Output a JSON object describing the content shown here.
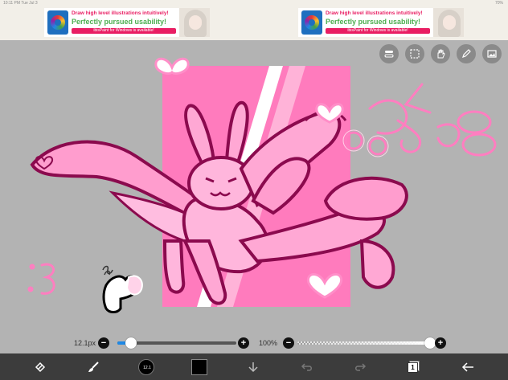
{
  "status_bar": {
    "time": "10:11 PM  Tue Jul 3",
    "right": "70%"
  },
  "ads": [
    {
      "line1": "Draw high level illustrations intuitively!",
      "line2": "Perfectly pursued usability!",
      "cta": "ibisPaint for Windows is available!"
    },
    {
      "line1": "Draw high level illustrations intuitively!",
      "line2": "Perfectly pursued usability!",
      "cta": "ibisPaint for Windows is available!"
    }
  ],
  "top_tools": [
    "layers-toggle-icon",
    "selection-icon",
    "hand-icon",
    "pen-icon",
    "image-icon"
  ],
  "brush": {
    "size_label": "12.1px",
    "size_value": 0.08,
    "opacity_label": "100%",
    "opacity_value": 1.0
  },
  "bottom_bar": {
    "brush_circle_label": "12.1",
    "layers_count": "1",
    "icons": [
      "transform-icon",
      "brush-icon",
      "brush-size-icon",
      "color-icon",
      "download-icon",
      "undo-icon",
      "redo-icon",
      "layers-icon",
      "back-icon"
    ]
  },
  "colors": {
    "accent": "#1e88e5",
    "pink": "#ff6eb4",
    "outline": "#8b0a4e",
    "toolbar": "#3c3c3c"
  }
}
